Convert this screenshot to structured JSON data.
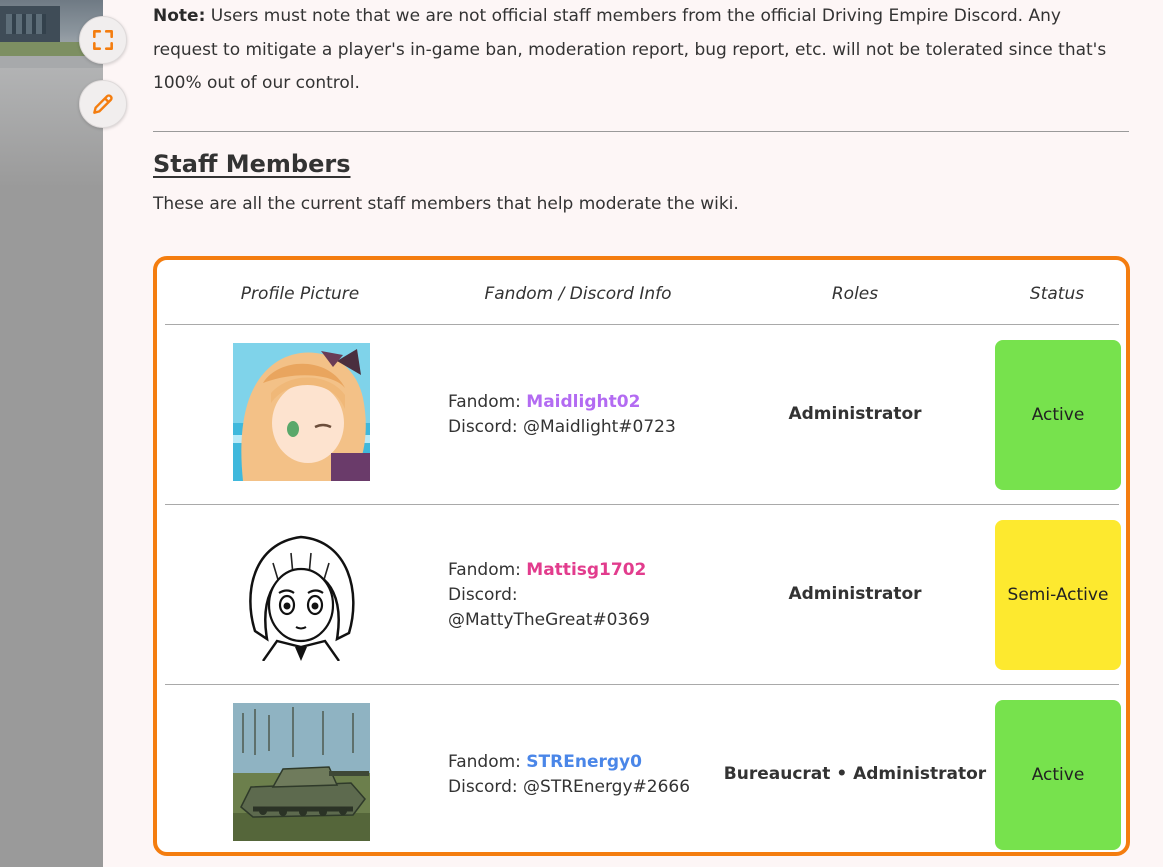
{
  "note": {
    "label": "Note:",
    "text": " Users must note that we are not official staff members from the official Driving Empire Discord. Any request to mitigate a player's in-game ban, moderation report, bug report, etc. will not be tolerated since that's 100% out of our control."
  },
  "section": {
    "title": "Staff Members",
    "subtitle": "These are all the current staff members that help moderate the wiki."
  },
  "table": {
    "headers": [
      "Profile Picture",
      "Fandom / Discord Info",
      "Roles",
      "Status"
    ],
    "fandom_prefix": "Fandom: ",
    "discord_prefix": "Discord: ",
    "rows": [
      {
        "fandom": "Maidlight02",
        "discord": "@Maidlight#0723",
        "role": "Administrator",
        "status": "Active"
      },
      {
        "fandom": "Mattisg1702",
        "discord": "@MattyTheGreat#0369",
        "role": "Administrator",
        "status": "Semi-Active"
      },
      {
        "fandom": "STREnergy0",
        "discord": "@STREnergy#2666",
        "role": "Bureaucrat • Administrator",
        "status": "Active"
      }
    ]
  },
  "colors": {
    "accent": "#f47d0f",
    "active": "#77e24d",
    "semi_active": "#fde92f",
    "handle_1": "#b36bf2",
    "handle_2": "#e23c8d",
    "handle_3": "#4a86e8"
  },
  "icons": {
    "fab_top": "fullscreen-icon",
    "fab_bottom": "pencil-icon"
  }
}
